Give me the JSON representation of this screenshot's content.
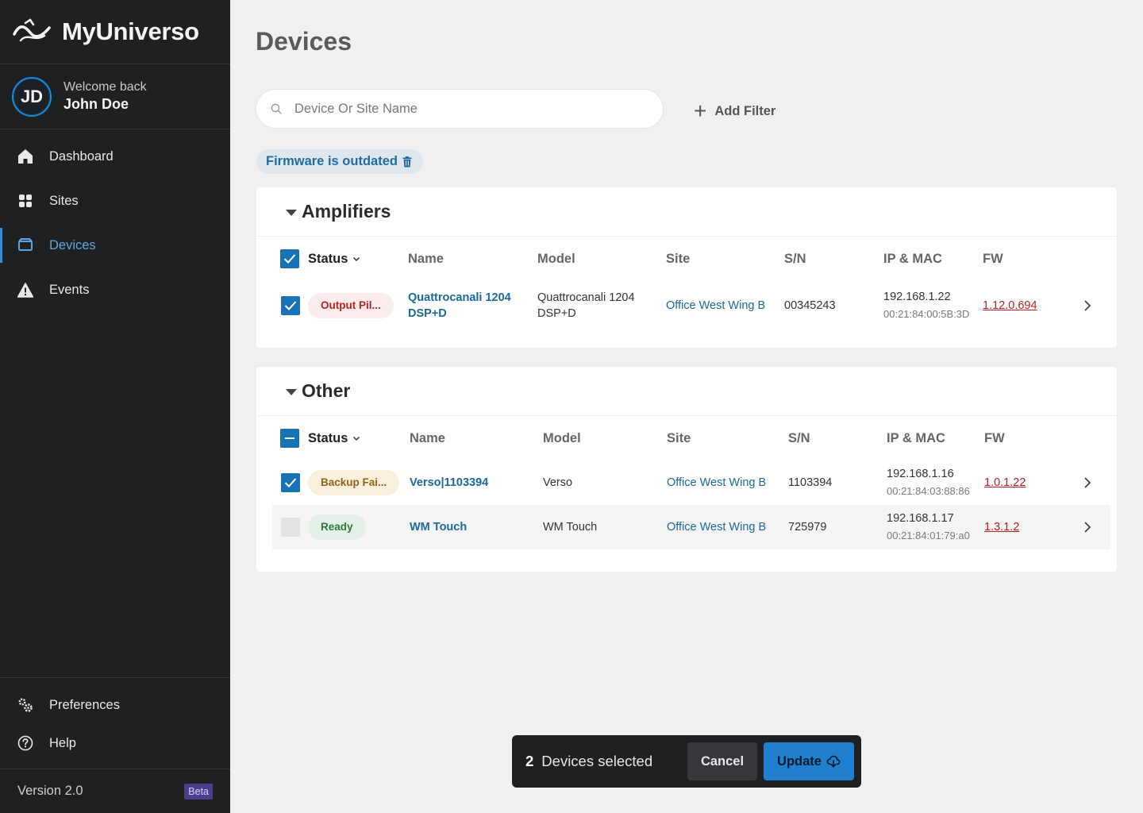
{
  "app": {
    "name": "MyUniverso"
  },
  "user": {
    "initials": "JD",
    "welcome": "Welcome back",
    "name": "John Doe"
  },
  "nav": [
    {
      "label": "Dashboard",
      "icon": "home-icon",
      "active": false
    },
    {
      "label": "Sites",
      "icon": "grid-icon",
      "active": false
    },
    {
      "label": "Devices",
      "icon": "device-icon",
      "active": true
    },
    {
      "label": "Events",
      "icon": "warning-icon",
      "active": false
    }
  ],
  "bottom_nav": [
    {
      "label": "Preferences",
      "icon": "gears-icon"
    },
    {
      "label": "Help",
      "icon": "help-icon"
    }
  ],
  "version": {
    "label": "Version 2.0",
    "badge": "Beta"
  },
  "page": {
    "title": "Devices"
  },
  "search": {
    "placeholder": "Device Or Site Name",
    "value": ""
  },
  "filters": {
    "add_label": "Add Filter",
    "active": [
      "Firmware is outdated"
    ]
  },
  "columns": {
    "status": "Status",
    "name": "Name",
    "model": "Model",
    "site": "Site",
    "sn": "S/N",
    "ipmac": "IP & MAC",
    "fw": "FW"
  },
  "groups": [
    {
      "title": "Amplifiers",
      "header_check": "checked",
      "rows": [
        {
          "checked": true,
          "status": "Output Pil...",
          "status_kind": "error",
          "name": "Quattrocanali 1204 DSP+D",
          "model": "Quattrocanali 1204 DSP+D",
          "site": "Office West Wing B",
          "sn": "00345243",
          "ip": "192.168.1.22",
          "mac": "00:21:84:00:5B:3D",
          "fw": "1.12.0.694"
        }
      ]
    },
    {
      "title": "Other",
      "header_check": "indeterminate",
      "rows": [
        {
          "checked": true,
          "status": "Backup Fai...",
          "status_kind": "warn",
          "name": "Verso|1103394",
          "model": "Verso",
          "site": "Office West Wing B",
          "sn": "1103394",
          "ip": "192.168.1.16",
          "mac": "00:21:84:03:88:86",
          "fw": "1.0.1.22"
        },
        {
          "checked": false,
          "status": "Ready",
          "status_kind": "ok",
          "name": "WM Touch",
          "model": "WM Touch",
          "site": "Office West Wing B",
          "sn": "725979",
          "ip": "192.168.1.17",
          "mac": "00:21:84:01:79:a0",
          "fw": "1.3.1.2"
        }
      ]
    }
  ],
  "selection": {
    "count": "2",
    "label": "Devices selected",
    "cancel": "Cancel",
    "update": "Update"
  },
  "colors": {
    "sidebar_bg": "#1f2022",
    "accent": "#1f7fd0",
    "link": "#1a6a9c",
    "error": "#b42323"
  }
}
